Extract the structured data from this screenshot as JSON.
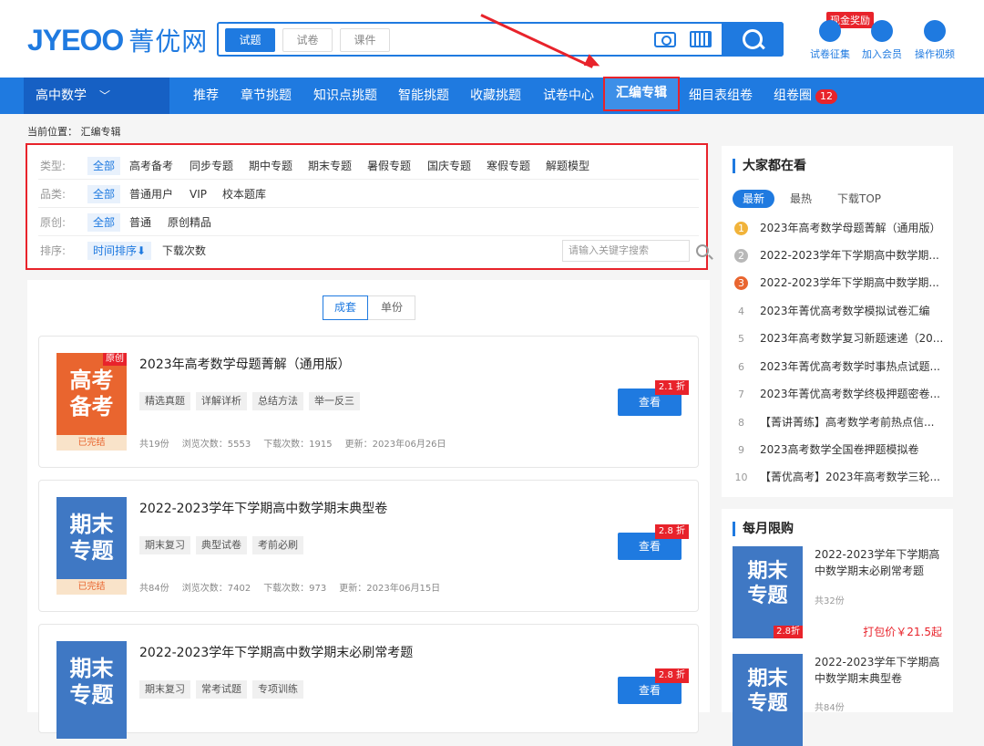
{
  "header": {
    "logo_latin": "JYEOO",
    "logo_cn": "菁优网",
    "search_tabs": [
      "试题",
      "试卷",
      "课件"
    ],
    "icons": [
      {
        "label": "试卷征集",
        "icon": "trophy-icon"
      },
      {
        "label": "加入会员",
        "icon": "vip-icon"
      },
      {
        "label": "操作视频",
        "icon": "play-icon"
      }
    ],
    "reward_badge": "现金奖励"
  },
  "nav": {
    "subject": "高中数学",
    "items": [
      "推荐",
      "章节挑题",
      "知识点挑题",
      "智能挑题",
      "收藏挑题",
      "试卷中心",
      "汇编专辑",
      "细目表组卷",
      "组卷圈"
    ],
    "badge": "12"
  },
  "breadcrumb": "当前位置： 汇编专辑",
  "filters": {
    "type_label": "类型:",
    "type_options": [
      "全部",
      "高考备考",
      "同步专题",
      "期中专题",
      "期末专题",
      "暑假专题",
      "国庆专题",
      "寒假专题",
      "解题模型"
    ],
    "category_label": "品类:",
    "category_options": [
      "全部",
      "普通用户",
      "VIP",
      "校本题库"
    ],
    "original_label": "原创:",
    "original_options": [
      "全部",
      "普通",
      "原创精品"
    ],
    "sort_label": "排序:",
    "sort_options": [
      "时间排序⬇",
      "下载次数"
    ],
    "keyword_placeholder": "请输入关键字搜索"
  },
  "toggle": [
    "成套",
    "单份"
  ],
  "cards": [
    {
      "cover_line1": "高考",
      "cover_line2": "备考",
      "cover_tag": "原创",
      "cover_status": "已完结",
      "title": "2023年高考数学母题菁解（通用版）",
      "tags": [
        "精选真题",
        "详解详析",
        "总结方法",
        "举一反三"
      ],
      "count": "共19份",
      "views": "浏览次数：5553",
      "downloads": "下载次数：1915",
      "updated": "更新：2023年06月26日",
      "discount": "2.1 折",
      "button": "查看"
    },
    {
      "cover_line1": "期末",
      "cover_line2": "专题",
      "cover_status": "已完结",
      "title": "2022-2023学年下学期高中数学期末典型卷",
      "tags": [
        "期末复习",
        "典型试卷",
        "考前必刷"
      ],
      "count": "共84份",
      "views": "浏览次数：7402",
      "downloads": "下载次数：973",
      "updated": "更新：2023年06月15日",
      "discount": "2.8 折",
      "button": "查看"
    },
    {
      "cover_line1": "期末",
      "cover_line2": "专题",
      "title": "2022-2023学年下学期高中数学期末必刷常考题",
      "tags": [
        "期末复习",
        "常考试题",
        "专项训练"
      ],
      "discount": "2.8 折",
      "button": "查看"
    }
  ],
  "hot": {
    "title": "大家都在看",
    "tabs": [
      "最新",
      "最热",
      "下载TOP"
    ],
    "items": [
      "2023年高考数学母题菁解（通用版）",
      "2022-2023学年下学期高中数学期...",
      "2022-2023学年下学期高中数学期...",
      "2023年菁优高考数学模拟试卷汇编",
      "2023年高考数学复习新题速递（20...",
      "2023年菁优高考数学时事热点试题...",
      "2023年菁优高考数学终极押题密卷...",
      "【菁讲菁练】高考数学考前热点信...",
      "2023高考数学全国卷押题模拟卷",
      "【菁优高考】2023年高考数学三轮..."
    ]
  },
  "limited": {
    "title": "每月限购",
    "items": [
      {
        "cover_line1": "期末",
        "cover_line2": "专题",
        "discount": "2.8折",
        "title": "2022-2023学年下学期高中数学期末必刷常考题",
        "count": "共32份",
        "price": "打包价￥21.5起"
      },
      {
        "cover_line1": "期末",
        "cover_line2": "专题",
        "title": "2022-2023学年下学期高中数学期末典型卷",
        "count": "共84份"
      }
    ]
  }
}
